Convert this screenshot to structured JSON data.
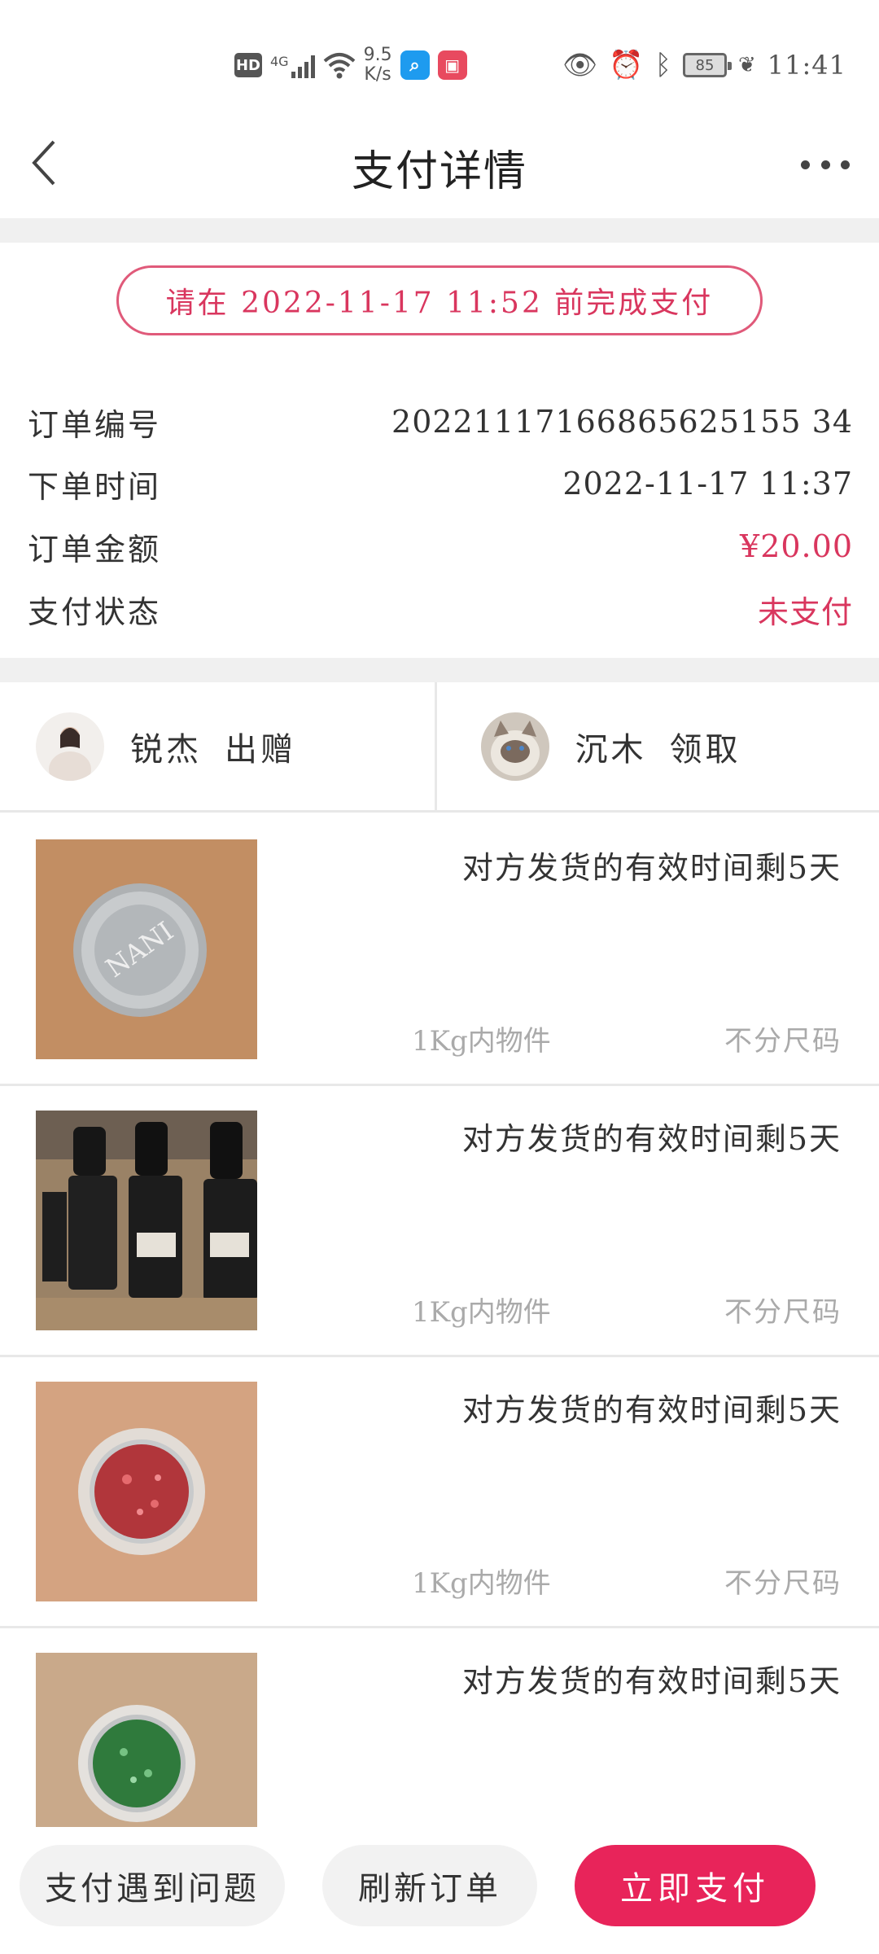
{
  "status_bar": {
    "hd_label": "HD",
    "network_label": "4G",
    "speed_value": "9.5",
    "speed_unit": "K/s",
    "battery_level": "85",
    "time": "11:41"
  },
  "header": {
    "title": "支付详情"
  },
  "deadline": {
    "text": "请在 2022-11-17 11:52 前完成支付"
  },
  "order_info": [
    {
      "label": "订单编号",
      "value": "20221117166865625155 34"
    },
    {
      "label": "下单时间",
      "value": "2022-11-17  11:37"
    },
    {
      "label": "订单金额",
      "value": "¥20.00"
    },
    {
      "label": "支付状态",
      "value": "未支付"
    }
  ],
  "users": {
    "giver": {
      "name": "锐杰",
      "action": "出赠"
    },
    "receiver": {
      "name": "沉木",
      "action": "领取"
    }
  },
  "items": [
    {
      "title": "对方发货的有效时间剩5天",
      "weight": "1Kg内物件",
      "size": "不分尺码"
    },
    {
      "title": "对方发货的有效时间剩5天",
      "weight": "1Kg内物件",
      "size": "不分尺码"
    },
    {
      "title": "对方发货的有效时间剩5天",
      "weight": "1Kg内物件",
      "size": "不分尺码"
    },
    {
      "title": "对方发货的有效时间剩5天"
    }
  ],
  "actions": {
    "problem": "支付遇到问题",
    "refresh": "刷新订单",
    "pay": "立即支付"
  },
  "colors": {
    "accent": "#e8245a",
    "accent_text": "#d9365e"
  }
}
